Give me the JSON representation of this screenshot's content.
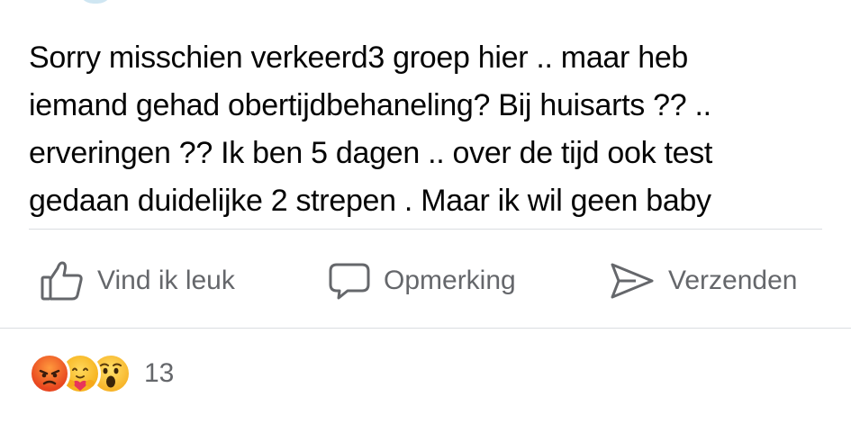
{
  "post": {
    "lines": [
      "Sorry misschien verkeerd3 groep hier .. maar heb",
      "iemand gehad obertijdbehaneling? Bij huisarts ?? ..",
      "erveringen ?? Ik ben 5 dagen .. over de tijd ook test",
      "gedaan duidelijke 2 strepen . Maar ik wil geen baby"
    ]
  },
  "actions": {
    "like_label": "Vind ik leuk",
    "comment_label": "Opmerking",
    "send_label": "Verzenden"
  },
  "reactions": {
    "icons": [
      "angry-emoji",
      "care-emoji",
      "wow-emoji"
    ],
    "count": "13"
  },
  "colors": {
    "text": "#050505",
    "secondary": "#65676b",
    "divider": "#dadde1"
  }
}
